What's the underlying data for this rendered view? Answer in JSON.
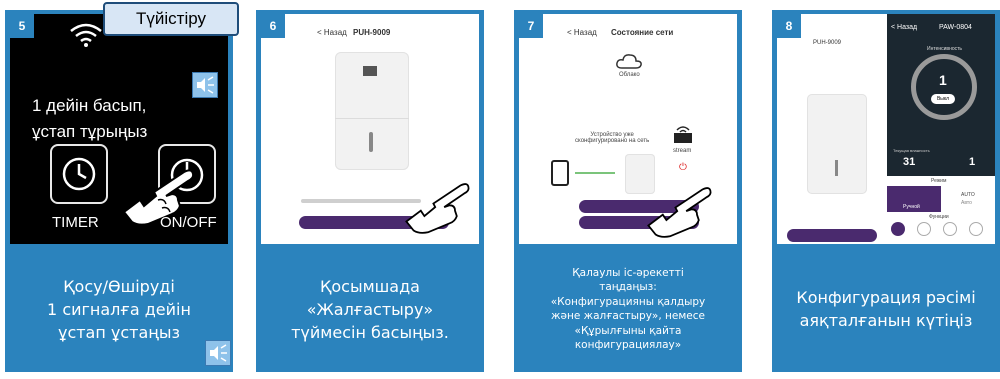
{
  "panels": [
    {
      "number": "5",
      "tooltip": "Түйістіру",
      "screen_lines": [
        "1 дейін басып,",
        "ұстап тұрыңыз"
      ],
      "button_labels": [
        "TIMER",
        "ON/OFF"
      ],
      "icons": [
        "wifi-icon",
        "speaker-icon",
        "timer-clock-icon",
        "power-icon",
        "pointing-hand-icon"
      ],
      "caption": "Қосу/Өшіруді\n1 сигналға дейін\nұстап ұстаңыз"
    },
    {
      "number": "6",
      "app": {
        "back": "< Назад",
        "title": "PUH-9009"
      },
      "caption": "Қосымшада\n«Жалғастыру»\nтүймесін басыңыз."
    },
    {
      "number": "7",
      "app": {
        "back": "< Назад",
        "title": "Состояние сети"
      },
      "cloud_label": "Облако",
      "device_text": "Устройство уже\nсконфигурировано на сеть",
      "router_label": "stream",
      "caption": "Қалаулы іс-әрекетті\nтаңдаңыз:\n«Конфигурацияны қалдыру\nжәне жалғастыру», немесе\n«Құрылғыны қайта\nконфигурациялау»"
    },
    {
      "number": "8",
      "app": {
        "back": "< Назад",
        "title": "PAW-0804",
        "left_title": "PUH-9009"
      },
      "intensity_label": "Интенсивность",
      "intensity_value": "1",
      "off_button": "Выкл",
      "humidity_label": "Текущая влажность",
      "humidity_value": "31",
      "intensity_bottom_value": "1",
      "mode_label": "Режим",
      "mode_manual": "Ручной",
      "mode_auto": "AUTO",
      "mode_auto_sub": "Авто",
      "functions_label": "Функции",
      "caption": "Конфигурация рәсімі\nаяқталғанын күтіңіз"
    }
  ],
  "colors": {
    "panel_blue": "#2b83bd",
    "app_button": "#4a2a6e"
  }
}
